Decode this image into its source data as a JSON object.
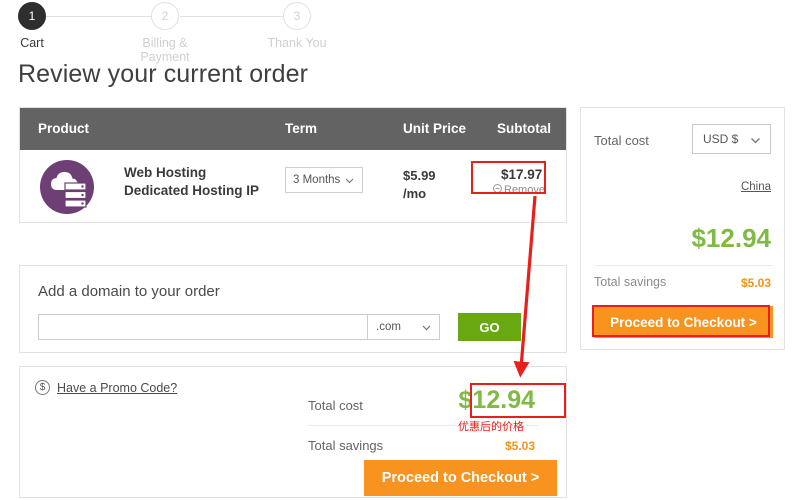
{
  "steps": {
    "items": [
      {
        "number": "1",
        "label": "Cart",
        "state": "active"
      },
      {
        "number": "2",
        "label": "Billing & Payment",
        "state": "inactive"
      },
      {
        "number": "3",
        "label": "Thank You",
        "state": "inactive"
      }
    ]
  },
  "page": {
    "title": "Review your current order"
  },
  "cart": {
    "columns": {
      "product": "Product",
      "term": "Term",
      "unit_price": "Unit Price",
      "subtotal": "Subtotal"
    },
    "rows": [
      {
        "icon": "cloud-server-icon",
        "name_line1": "Web Hosting",
        "name_line2": "Dedicated Hosting IP",
        "term": "3 Months",
        "unit_price_line1": "$5.99",
        "unit_price_line2": "/mo",
        "subtotal": "$17.97",
        "remove_label": "Remove"
      }
    ]
  },
  "domain": {
    "title": "Add a domain to your order",
    "input_value": "",
    "input_placeholder": "",
    "tld": ".com",
    "go_label": "GO"
  },
  "summary": {
    "promo_label": "Have a Promo Code?",
    "promo_icon": "dollar-circle-icon",
    "total_cost_label": "Total cost",
    "total_cost_value": "$12.94",
    "total_savings_label": "Total savings",
    "total_savings_value": "$5.03",
    "checkout_label": "Proceed to Checkout >"
  },
  "sidebar": {
    "total_cost_label": "Total cost",
    "currency": "USD $",
    "country": "China",
    "total_cost_value": "$12.94",
    "total_savings_label": "Total savings",
    "total_savings_value": "$5.03",
    "checkout_label": "Proceed to Checkout >"
  },
  "annotations": {
    "chinese_note": "优惠后的价格",
    "highlight_color": "#e8201c"
  },
  "colors": {
    "accent_orange": "#f7931e",
    "accent_green": "#7fbb42",
    "go_green": "#6aa812",
    "savings_orange": "#f0941a",
    "header_gray": "#636363",
    "product_purple": "#6d3f74"
  }
}
